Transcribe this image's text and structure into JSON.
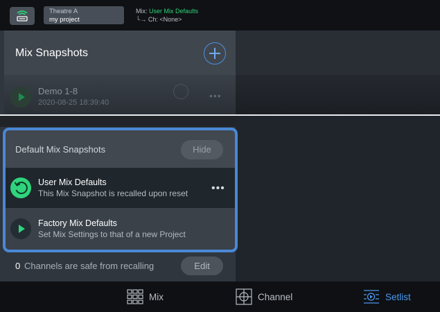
{
  "header": {
    "project_venue": "Theatre A",
    "project_name": "my project",
    "mix_label": "Mix:",
    "mix_value": "User Mix Defaults",
    "channel_line": "└→ Ch: <None>"
  },
  "snapshots": {
    "title": "Mix Snapshots",
    "items": [
      {
        "name": "Demo 1-8",
        "date": "2020-08-25 18:39:40",
        "more": "•••"
      }
    ]
  },
  "defaults": {
    "title": "Default Mix Snapshots",
    "hide_label": "Hide",
    "user": {
      "name": "User Mix Defaults",
      "description": "This Mix Snapshot is recalled upon reset",
      "more": "•••"
    },
    "factory": {
      "name": "Factory Mix Defaults",
      "description": "Set Mix Settings to that of a new Project"
    }
  },
  "channels_safe": {
    "count": "0",
    "text": "Channels are safe from recalling",
    "edit_label": "Edit"
  },
  "nav": {
    "mix": "Mix",
    "channel": "Channel",
    "setlist": "Setlist",
    "active": "setlist"
  },
  "colors": {
    "accent_blue": "#4a88d6",
    "accent_green": "#2fd47c",
    "active_tab": "#4a98ee"
  }
}
